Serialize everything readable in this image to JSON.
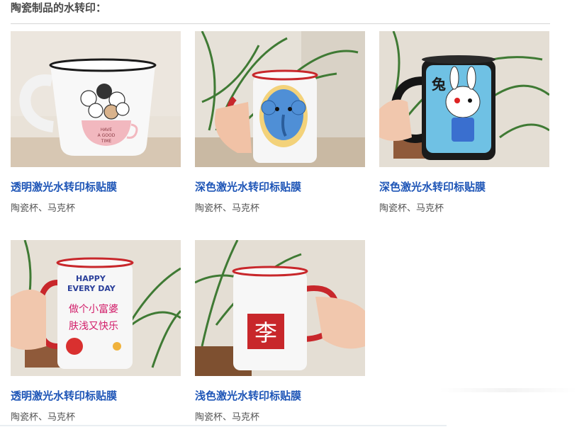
{
  "section": {
    "title": "陶瓷制品的水转印："
  },
  "products": [
    {
      "title": "透明激光水转印标贴膜",
      "subtitle": "陶瓷杯、马克杯",
      "image": "white-mug-cats-have-a-good-time"
    },
    {
      "title": "深色激光水转印标贴膜",
      "subtitle": "陶瓷杯、马克杯",
      "image": "white-mug-blue-elephant-red-handle"
    },
    {
      "title": "深色激光水转印标贴膜",
      "subtitle": "陶瓷杯、马克杯",
      "image": "black-mug-white-rabbit-cartoon"
    },
    {
      "title": "透明激光水转印标贴膜",
      "subtitle": "陶瓷杯、马克杯",
      "image": "white-mug-happy-every-day"
    },
    {
      "title": "浅色激光水转印标贴膜",
      "subtitle": "陶瓷杯、马克杯",
      "image": "white-mug-red-seal-li"
    }
  ],
  "mug_text": {
    "cat_cup": [
      "HAVE",
      "A GOOD",
      "TIME"
    ],
    "rabbit_char": "兔",
    "happy_lines": [
      "HAPPY",
      "EVERY DAY",
      "做个小富婆",
      "肤浅又快乐"
    ],
    "seal_char": "李"
  },
  "colors": {
    "title_blue": "#1f56b7",
    "sub_gray": "#555555",
    "heading": "#4b4b4b"
  }
}
